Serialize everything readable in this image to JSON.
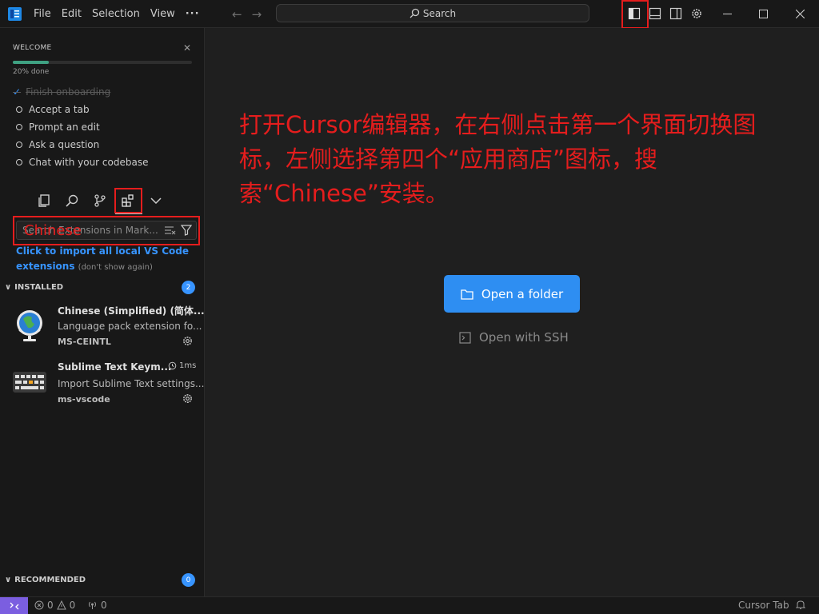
{
  "titlebar": {
    "menu": [
      "File",
      "Edit",
      "Selection",
      "View"
    ],
    "more": "···",
    "search": "Search"
  },
  "welcome": {
    "title": "WELCOME",
    "progress_percent": 20,
    "progress_label": "20% done",
    "items": [
      {
        "label": "Finish onboarding",
        "done": true
      },
      {
        "label": "Accept a tab",
        "done": false
      },
      {
        "label": "Prompt an edit",
        "done": false
      },
      {
        "label": "Ask a question",
        "done": false
      },
      {
        "label": "Chat with your codebase",
        "done": false
      }
    ]
  },
  "extensions": {
    "search_placeholder": "Search Extensions in Mark...",
    "typed_annotation": "Chinese",
    "import_link": "Click to import all local VS Code extensions",
    "import_note": "(don't show again)",
    "installed_label": "INSTALLED",
    "installed_count": "2",
    "recommended_label": "RECOMMENDED",
    "recommended_count": "0",
    "items": [
      {
        "name": "Chinese (Simplified) (简体...",
        "description": "Language pack extension fo...",
        "publisher": "MS-CEINTL",
        "time": ""
      },
      {
        "name": "Sublime Text Keym...",
        "description": "Import Sublime Text settings...",
        "publisher": "ms-vscode",
        "time": "1ms"
      }
    ]
  },
  "editor": {
    "annotation": "打开Cursor编辑器，在右侧点击第一个界面切换图标，左侧选择第四个“应用商店”图标，搜索“Chinese”安装。",
    "open_folder": "Open a folder",
    "open_ssh": "Open with SSH"
  },
  "statusbar": {
    "errors": "0",
    "warnings": "0",
    "ports": "0",
    "cursor_tab": "Cursor Tab"
  },
  "colors": {
    "accent": "#2e8ef2",
    "annotation_red": "#e51d1d",
    "badge_blue": "#3794ff",
    "progress_green": "#3fa182",
    "remote_purple": "#7b5ee0"
  }
}
